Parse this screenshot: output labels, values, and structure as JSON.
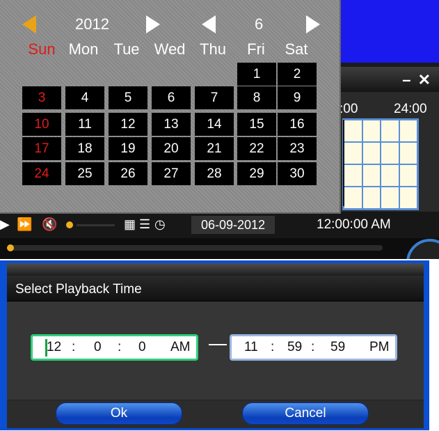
{
  "calendar": {
    "year": "2012",
    "month": "6",
    "weekdays": [
      "Sun",
      "Mon",
      "Tue",
      "Wed",
      "Thu",
      "Fri",
      "Sat"
    ],
    "days": {
      "d1": "1",
      "d2": "2",
      "d3": "3",
      "d4": "4",
      "d5": "5",
      "d6": "6",
      "d7": "7",
      "d8": "8",
      "d9": "9",
      "d10": "10",
      "d11": "11",
      "d12": "12",
      "d13": "13",
      "d14": "14",
      "d15": "15",
      "d16": "16",
      "d17": "17",
      "d18": "18",
      "d19": "19",
      "d20": "20",
      "d21": "21",
      "d22": "22",
      "d23": "23",
      "d24": "24",
      "d25": "25",
      "d26": "26",
      "d27": "27",
      "d28": "28",
      "d29": "29",
      "d30": "30"
    },
    "sunday_color": "#e01b1b",
    "year_prev_arrow_color": "#e8a317"
  },
  "timeline": {
    "start_label": ":00",
    "end_label": "24:00",
    "close_label": "– ✕"
  },
  "playback": {
    "date": "06-09-2012",
    "time": "12:00:00 AM"
  },
  "icons": [
    "fast-forward-icon",
    "mute-icon",
    "layout-grid-icon",
    "list-icon",
    "clock-icon"
  ],
  "dialog": {
    "title": "Select Playback Time",
    "start": {
      "hour": "12",
      "min": "0",
      "sec": "0",
      "ampm": "AM"
    },
    "end": {
      "hour": "11",
      "min": "59",
      "sec": "59",
      "ampm": "PM"
    },
    "separator": ":",
    "ok_label": "Ok",
    "cancel_label": "Cancel",
    "accent_color": "#0b4fd2"
  }
}
